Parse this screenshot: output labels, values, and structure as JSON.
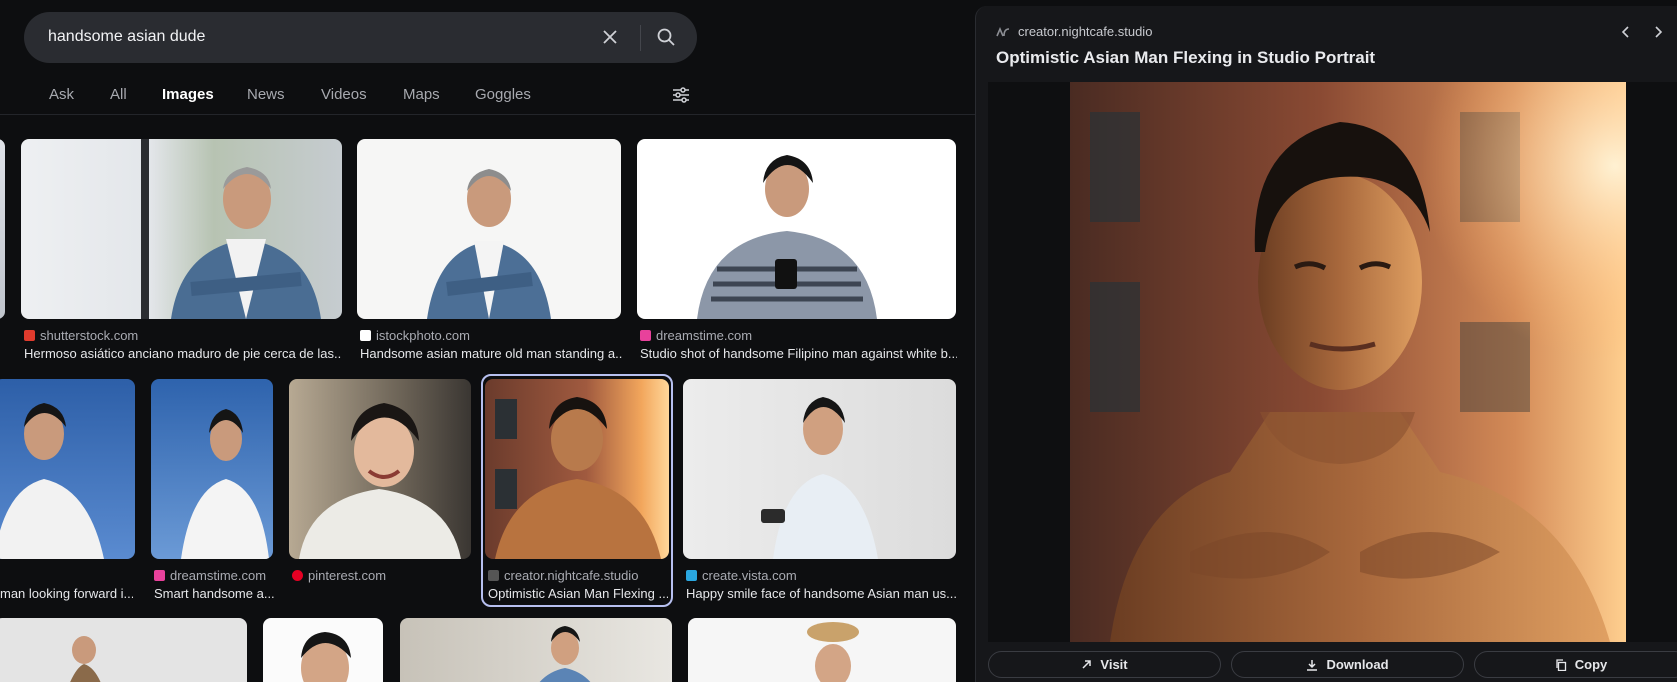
{
  "search": {
    "query": "handsome asian dude"
  },
  "tabs": [
    "Ask",
    "All",
    "Images",
    "News",
    "Videos",
    "Maps",
    "Goggles"
  ],
  "active_tab": "Images",
  "results": [
    {
      "source": "shutterstock.com",
      "caption": "Hermoso asiático anciano maduro de pie cerca de las...",
      "fav_color": "#e03b2d"
    },
    {
      "source": "istockphoto.com",
      "caption": "Handsome asian mature old man standing a...",
      "fav_color": "#ffffff"
    },
    {
      "source": "dreamstime.com",
      "caption": "Studio shot of handsome Filipino man against white b...",
      "fav_color": "#e8419b"
    },
    {
      "source": "",
      "caption": "man looking forward i...",
      "fav_color": ""
    },
    {
      "source": "dreamstime.com",
      "caption": "Smart handsome a...",
      "fav_color": "#e8419b"
    },
    {
      "source": "pinterest.com",
      "caption": "",
      "fav_color": "#e60023"
    },
    {
      "source": "creator.nightcafe.studio",
      "caption": "Optimistic Asian Man Flexing ...",
      "fav_color": "#555555"
    },
    {
      "source": "create.vista.com",
      "caption": "Happy smile face of handsome Asian man us...",
      "fav_color": "#2aa7e0"
    }
  ],
  "preview": {
    "source": "creator.nightcafe.studio",
    "title": "Optimistic Asian Man Flexing in Studio Portrait"
  },
  "actions": {
    "visit": "Visit",
    "download": "Download",
    "copy": "Copy"
  },
  "icons": [
    "close-icon",
    "search-icon",
    "filters-icon",
    "chevron-left-icon",
    "chevron-right-icon",
    "external-link-icon",
    "download-icon",
    "copy-icon"
  ]
}
